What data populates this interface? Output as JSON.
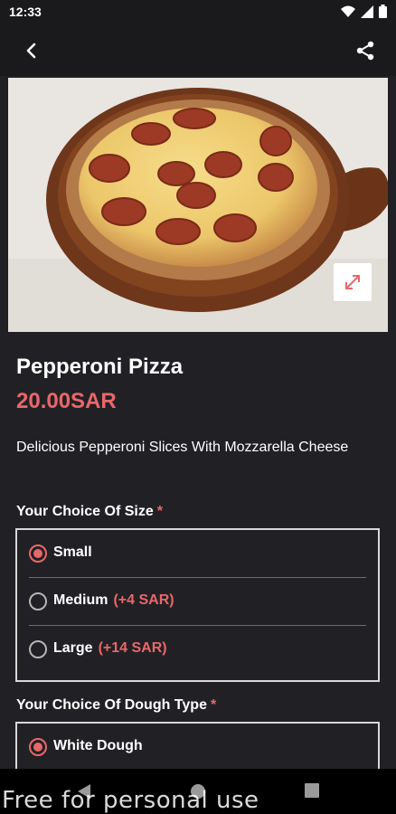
{
  "status_bar": {
    "time": "12:33"
  },
  "product": {
    "name": "Pepperoni Pizza",
    "price": "20.00SAR",
    "description": "Delicious Pepperoni Slices With Mozzarella Cheese"
  },
  "size_group": {
    "label": "Your Choice Of Size",
    "required_mark": "*",
    "options": [
      {
        "label": "Small",
        "extra": "",
        "selected": true
      },
      {
        "label": "Medium",
        "extra": "(+4 SAR)",
        "selected": false
      },
      {
        "label": "Large",
        "extra": "(+14 SAR)",
        "selected": false
      }
    ]
  },
  "dough_group": {
    "label": "Your Choice Of Dough Type",
    "required_mark": "*",
    "options": [
      {
        "label": "White Dough",
        "extra": "",
        "selected": true
      }
    ]
  },
  "watermark": "Free for personal use",
  "colors": {
    "accent": "#e9676a",
    "background": "#212125"
  }
}
